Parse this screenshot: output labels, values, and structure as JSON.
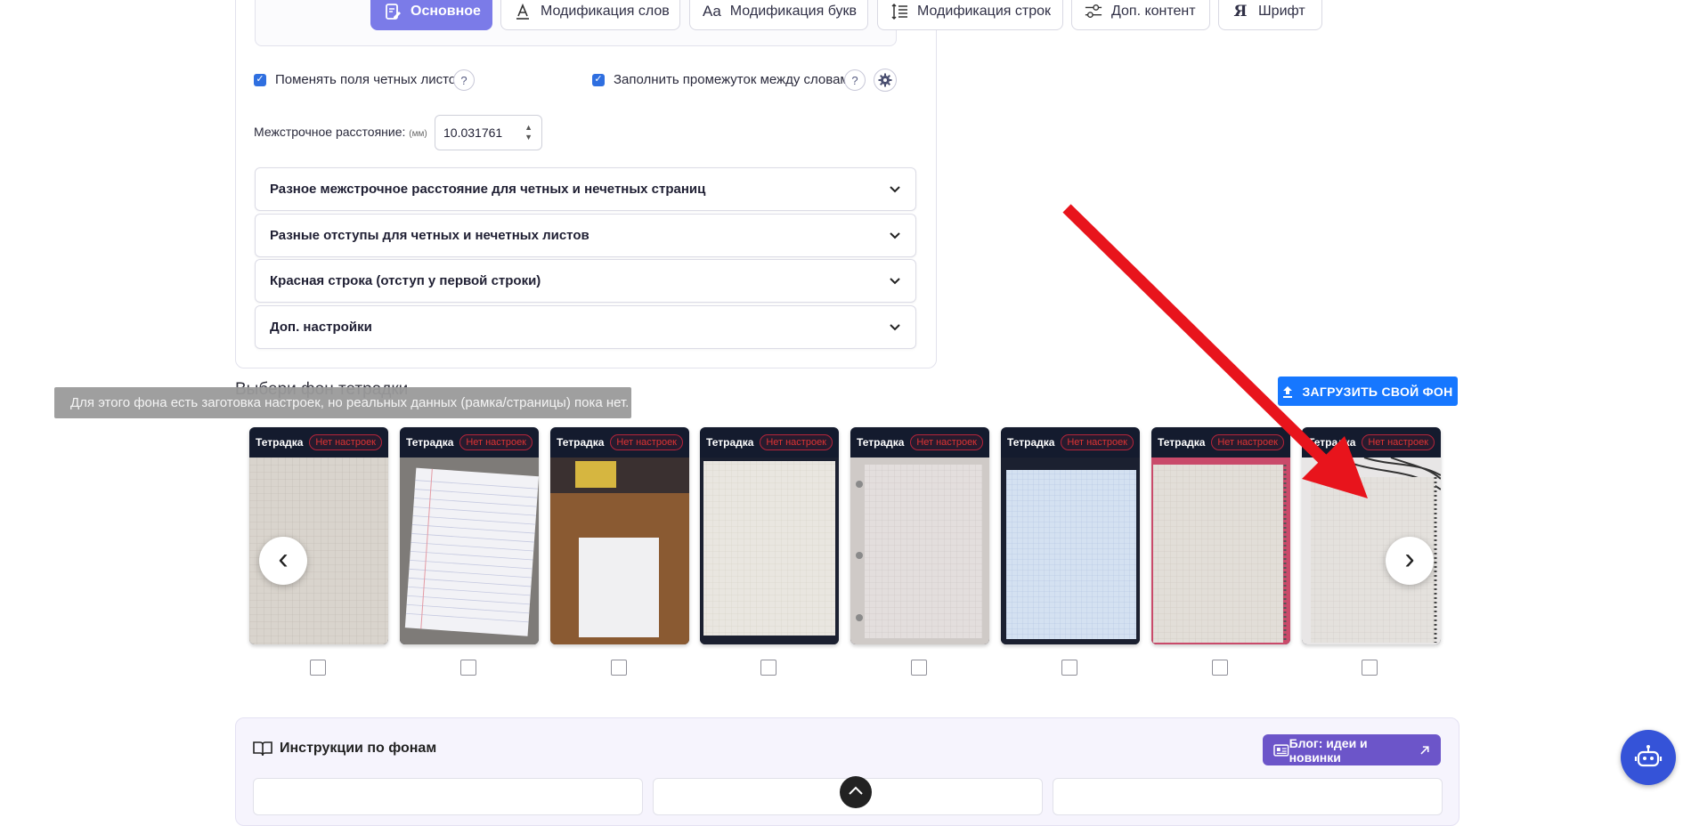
{
  "tabs": [
    {
      "label": "Основное",
      "icon": "edit-doc-icon",
      "active": true
    },
    {
      "label": "Модификация слов",
      "icon": "underline-a-icon",
      "active": false
    },
    {
      "label": "Модификация букв",
      "icon": "aa-letters-icon",
      "active": false
    },
    {
      "label": "Модификация строк",
      "icon": "line-spacing-icon",
      "active": false
    },
    {
      "label": "Доп. контент",
      "icon": "sliders-icon",
      "active": false
    },
    {
      "label": "Шрифт",
      "icon": "font-icon",
      "active": false
    }
  ],
  "options": {
    "swap_margins_label": "Поменять поля четных листов",
    "fill_gap_label": "Заполнить промежуток между словами",
    "help": "?"
  },
  "line_spacing": {
    "label": "Межстрочное расстояние:",
    "unit": "(мм)",
    "value": "10.031761"
  },
  "accordions": [
    "Разное межстрочное расстояние для четных и нечетных страниц",
    "Разные отступы для четных и нечетных листов",
    "Красная строка (отступ у первой строки)",
    "Доп. настройки"
  ],
  "backgrounds": {
    "title": "Выбери фон тетрадки",
    "tooltip": "Для этого фона есть заготовка настроек, но реальных данных (рамка/страницы) пока нет.",
    "upload_label": "ЗАГРУЗИТЬ СВОЙ ФОН",
    "cards": [
      {
        "title": "Тетрадка",
        "badge": "Нет настроек"
      },
      {
        "title": "Тетрадка",
        "badge": "Нет настроек"
      },
      {
        "title": "Тетрадка",
        "badge": "Нет настроек"
      },
      {
        "title": "Тетрадка",
        "badge": "Нет настроек"
      },
      {
        "title": "Тетрадка",
        "badge": "Нет настроек"
      },
      {
        "title": "Тетрадка",
        "badge": "Нет настроек"
      },
      {
        "title": "Тетрадка",
        "badge": "Нет настроек"
      },
      {
        "title": "Тетрадка",
        "badge": "Нет настроек"
      }
    ],
    "prev_icon": "‹",
    "next_icon": "›"
  },
  "instructions": {
    "title": "Инструкции по фонам",
    "blog_label": "Блог: идеи и новинки"
  },
  "colors": {
    "accent": "#7b7be8",
    "upload": "#1677ff",
    "blog": "#6c55c9",
    "arrow": "#e8141c"
  }
}
